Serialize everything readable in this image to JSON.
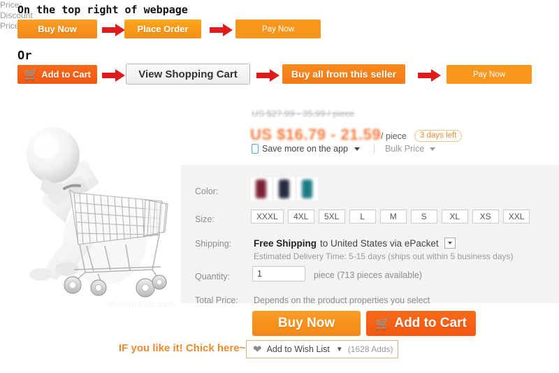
{
  "flow": {
    "heading_top": "On the top right of webpage",
    "heading_or": "Or",
    "row1": [
      {
        "label": "Buy Now",
        "style": "grad-orange"
      },
      {
        "label": "Place Order",
        "style": "grad-orange-light"
      },
      {
        "label": "Pay Now",
        "style": "flat-orange"
      }
    ],
    "row2": [
      {
        "label": "Add to Cart",
        "style": "grad-red-orange",
        "icon": "cart-icon"
      },
      {
        "label": "View Shopping Cart",
        "style": "gray-btn"
      },
      {
        "label": "Buy all from this seller",
        "style": "grad-orange-deep"
      },
      {
        "label": "Pay Now",
        "style": "flat-orange"
      }
    ],
    "arrow_icon": "right-arrow-icon",
    "arrow_color": "#e01b1b"
  },
  "product": {
    "image_alt": "3d-figure-pushing-shopping-cart",
    "watermark": "dreamstime.com"
  },
  "price": {
    "label_price": "Price:",
    "label_discount": "Discount Price:",
    "original": "US $27.99 - 35.99 / piece",
    "discount": "US $16.79 - 21.59",
    "unit": "/ piece",
    "days_left": "3 days left",
    "app_link": "Save more on the app",
    "app_icon": "mobile-phone-icon",
    "bulk_price": "Bulk Price",
    "accent_color": "#f4793c"
  },
  "options": {
    "color_label": "Color:",
    "colors": [
      {
        "name": "maroon",
        "hex": "#7d2236"
      },
      {
        "name": "navy",
        "hex": "#262b3f"
      },
      {
        "name": "teal",
        "hex": "#1d7b86"
      }
    ],
    "size_label": "Size:",
    "sizes": [
      "XXXL",
      "4XL",
      "5XL",
      "L",
      "M",
      "S",
      "XL",
      "XS",
      "XXL"
    ],
    "shipping_label": "Shipping:",
    "shipping_free": "Free Shipping",
    "shipping_dest": "to United States via ePacket",
    "shipping_eta": "Estimated Delivery Time: 5-15 days (ships out within 5 business days)",
    "quantity_label": "Quantity:",
    "quantity_value": "1",
    "quantity_placeholder": "1",
    "quantity_note": "piece (713 pieces available)",
    "total_label": "Total Price:",
    "total_note": "Depends on the product properties you select"
  },
  "actions": {
    "buy_now": "Buy Now",
    "add_to_cart": "Add to Cart",
    "cart_icon": "cart-icon"
  },
  "wishlist": {
    "annotation": "IF you like it! Chick here~",
    "label": "Add to Wish List",
    "count": "(1628 Adds)",
    "heart_icon": "heart-icon",
    "chevron_icon": "chevron-down-icon"
  }
}
